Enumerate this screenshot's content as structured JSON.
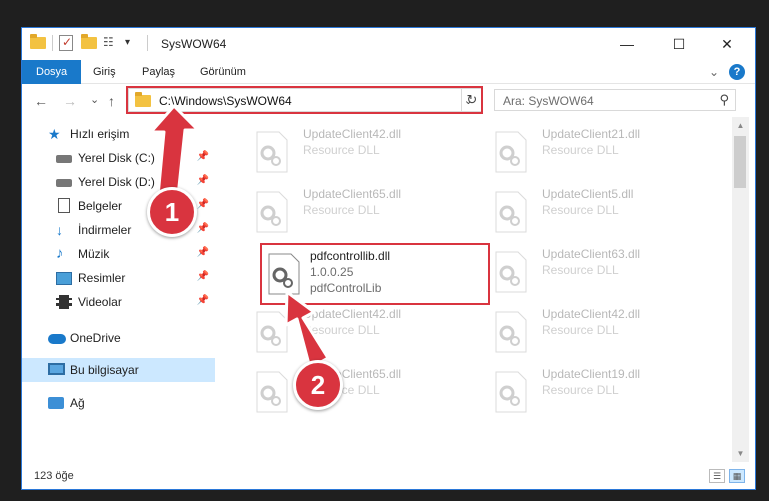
{
  "window": {
    "title": "SysWOW64",
    "controls": {
      "minimize": "—",
      "maximize": "☐",
      "close": "✕"
    }
  },
  "ribbon": {
    "tabs": [
      {
        "label": "Dosya",
        "active": true
      },
      {
        "label": "Giriş",
        "active": false
      },
      {
        "label": "Paylaş",
        "active": false
      },
      {
        "label": "Görünüm",
        "active": false
      }
    ],
    "expand_glyph": "⌄",
    "help_glyph": "?"
  },
  "address": {
    "path": "C:\\Windows\\SysWOW64",
    "search_placeholder": "Ara: SysWOW64",
    "back_glyph": "←",
    "forward_glyph": "→",
    "recent_glyph": "⌄",
    "up_glyph": "↑",
    "dropdown_glyph": "⌄",
    "refresh_glyph": "↻",
    "search_glyph": "⚲"
  },
  "nav": {
    "items": [
      {
        "label": "Hızlı erişim",
        "icon": "star-icon",
        "pinned": false
      },
      {
        "label": "Yerel Disk (C:)",
        "icon": "drive-icon",
        "pinned": true
      },
      {
        "label": "Yerel Disk (D:)",
        "icon": "drive-icon",
        "pinned": true
      },
      {
        "label": "Belgeler",
        "icon": "documents-icon",
        "pinned": true
      },
      {
        "label": "İndirmeler",
        "icon": "downloads-icon",
        "pinned": true
      },
      {
        "label": "Müzik",
        "icon": "music-icon",
        "pinned": true
      },
      {
        "label": "Resimler",
        "icon": "pictures-icon",
        "pinned": true
      },
      {
        "label": "Videolar",
        "icon": "videos-icon",
        "pinned": true
      },
      {
        "label": "OneDrive",
        "icon": "onedrive-icon",
        "pinned": false
      },
      {
        "label": "Bu bilgisayar",
        "icon": "this-pc-icon",
        "pinned": false,
        "selected": true
      },
      {
        "label": "Ağ",
        "icon": "network-icon",
        "pinned": false
      }
    ],
    "pin_glyph": "📌"
  },
  "files": [
    {
      "name": "UpdateClient42.dll",
      "line2": "Resource DLL",
      "faded": true
    },
    {
      "name": "UpdateClient21.dll",
      "line2": "Resource DLL",
      "faded": true
    },
    {
      "name": "UpdateClient65.dll",
      "line2": "Resource DLL",
      "faded": true
    },
    {
      "name": "UpdateClient5.dll",
      "line2": "Resource DLL",
      "faded": true
    },
    {
      "name": "pdfcontrollib.dll",
      "line2": "1.0.0.25",
      "line3": "pdfControlLib",
      "faded": false,
      "highlighted": true
    },
    {
      "name": "UpdateClient63.dll",
      "line2": "Resource DLL",
      "faded": true
    },
    {
      "name": "UpdateClient42.dll",
      "line2": "Resource DLL",
      "faded": true
    },
    {
      "name": "UpdateClient42.dll",
      "line2": "Resource DLL",
      "faded": true
    },
    {
      "name": "UpdateClient65.dll",
      "line2": "Resource DLL",
      "faded": true
    },
    {
      "name": "UpdateClient19.dll",
      "line2": "Resource DLL",
      "faded": true
    }
  ],
  "status": {
    "count": "123 öğe"
  },
  "scrollbar": {
    "up_glyph": "▲",
    "down_glyph": "▼"
  },
  "view_buttons": {
    "details_glyph": "☰",
    "tiles_glyph": "▦"
  },
  "annotations": {
    "step1": "1",
    "step2": "2",
    "color": "#d9343f"
  },
  "colors": {
    "accent": "#1979ca",
    "highlight": "#d9343f",
    "selection": "#cce8ff"
  }
}
